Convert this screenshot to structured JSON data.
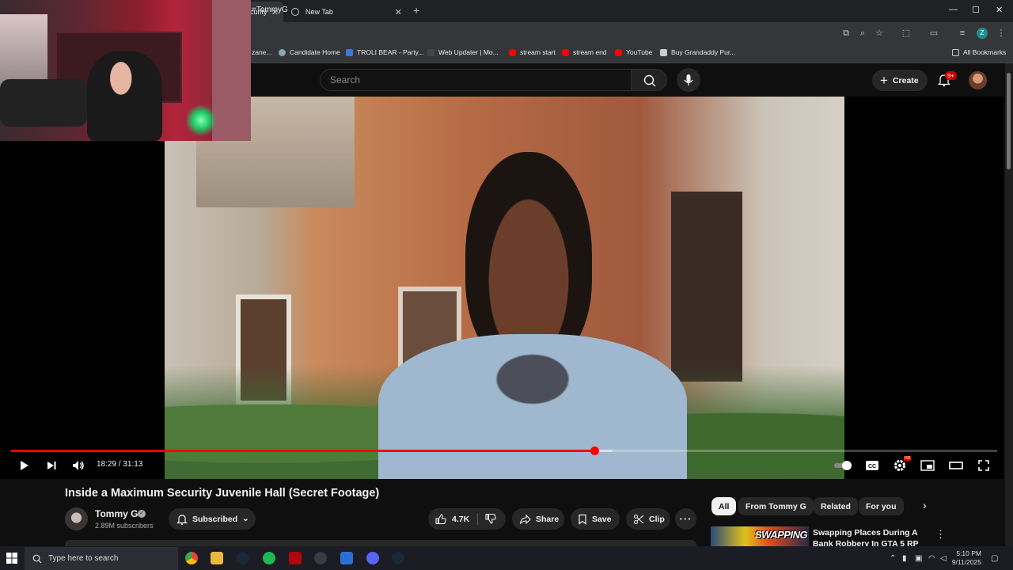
{
  "browser": {
    "tabs": [
      {
        "title": "curity",
        "active": true
      },
      {
        "title": "New Tab",
        "active": false
      }
    ],
    "address_bar": "=TommyG",
    "bookmarks": [
      {
        "label": "zane..."
      },
      {
        "label": "Candidate Home"
      },
      {
        "label": "TROLI BEAR - Party..."
      },
      {
        "label": "Web Updater | Mo..."
      },
      {
        "label": "stream start"
      },
      {
        "label": "stream end"
      },
      {
        "label": "YouTube"
      },
      {
        "label": "Buy Grandaddy Pur..."
      }
    ],
    "all_bookmarks": "All Bookmarks",
    "profile_initial": "Z"
  },
  "youtube": {
    "search_placeholder": "Search",
    "create_label": "Create",
    "notification_badge": "9+",
    "player": {
      "time_display": "18:29 / 31:13",
      "progress_fraction": 0.592,
      "buffer_fraction": 0.61,
      "quality_badge": "HD"
    },
    "video": {
      "title": "Inside a Maximum Security Juvenile Hall (Secret Footage)",
      "channel_name": "Tommy G",
      "subscribers": "2.89M subscribers",
      "subscribe_state": "Subscribed",
      "likes": "4.7K",
      "share_label": "Share",
      "save_label": "Save",
      "clip_label": "Clip"
    },
    "chips": [
      "All",
      "From Tommy G",
      "Related",
      "For you"
    ],
    "recommendation": {
      "title": "Swapping Places During A Bank Robbery In GTA 5 RP",
      "thumb_text": "SWAPPING"
    }
  },
  "taskbar": {
    "search_placeholder": "Type here to search",
    "time": "5:10 PM",
    "date": "9/11/2025"
  },
  "colors": {
    "yt_red": "#ff0000",
    "background": "#0f0f0f",
    "chip_bg": "#272727"
  }
}
